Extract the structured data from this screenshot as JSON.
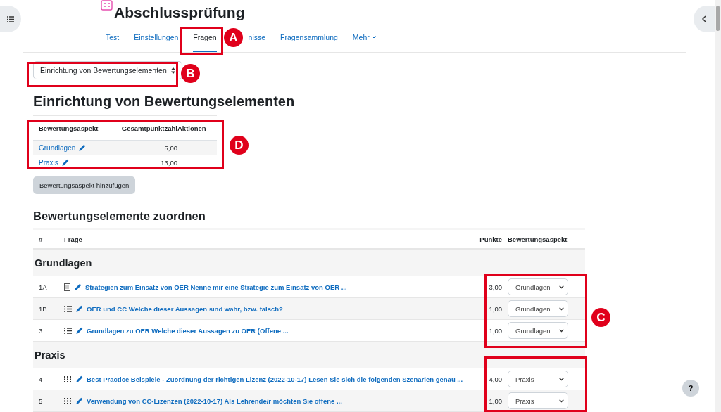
{
  "page": {
    "title": "Abschlussprüfung"
  },
  "tabs": [
    {
      "label": "Test",
      "selected": false
    },
    {
      "label": "Einstellungen",
      "selected": false
    },
    {
      "label": "Fragen",
      "selected": true
    },
    {
      "label": "nisse",
      "selected": false
    },
    {
      "label": "Fragensammlung",
      "selected": false
    },
    {
      "label": "Mehr",
      "selected": false,
      "dropdown": true
    }
  ],
  "view_select": {
    "value": "Einrichtung von Bewertungselementen"
  },
  "setup_heading": "Einrichtung von Bewertungselementen",
  "aspects_table": {
    "columns": [
      "Bewertungsaspekt",
      "Gesamtpunktzahl",
      "Aktionen"
    ],
    "rows": [
      {
        "name": "Grundlagen",
        "total": "5,00"
      },
      {
        "name": "Praxis",
        "total": "13,00"
      }
    ]
  },
  "add_button": "Bewertungsaspekt hinzufügen",
  "assign_heading": "Bewertungselemente zuordnen",
  "questions_table": {
    "columns": [
      "#",
      "Frage",
      "Punkte",
      "Bewertungsaspekt"
    ],
    "groups": [
      {
        "title": "Grundlagen",
        "rows": [
          {
            "number": "1A",
            "kind": "essay",
            "question": "Strategien zum Einsatz von OER Nenne mir eine Strategie zum Einsatz von OER ...",
            "points": "3,00",
            "aspect": "Grundlagen"
          },
          {
            "number": "1B",
            "kind": "multichoice",
            "question": "OER und CC Welche dieser Aussagen sind wahr, bzw. falsch?",
            "points": "1,00",
            "aspect": "Grundlagen"
          },
          {
            "number": "3",
            "kind": "multichoice",
            "question": "Grundlagen zu OER Welche dieser Aussagen zu OER (Offene ...",
            "points": "1,00",
            "aspect": "Grundlagen"
          }
        ]
      },
      {
        "title": "Praxis",
        "rows": [
          {
            "number": "4",
            "kind": "matching",
            "question": "Best Practice Beispiele - Zuordnung der richtigen Lizenz (2022-10-17) Lesen Sie sich die folgenden Szenarien genau ...",
            "points": "4,00",
            "aspect": "Praxis"
          },
          {
            "number": "5",
            "kind": "matching",
            "question": "Verwendung von CC-Lizenzen (2022-10-17) Als Lehrende/r möchten Sie offene ...",
            "points": "1,00",
            "aspect": "Praxis"
          }
        ]
      }
    ]
  },
  "help_button": "?",
  "annotations": [
    {
      "label": "A"
    },
    {
      "label": "B"
    },
    {
      "label": "C"
    },
    {
      "label": "D"
    }
  ]
}
